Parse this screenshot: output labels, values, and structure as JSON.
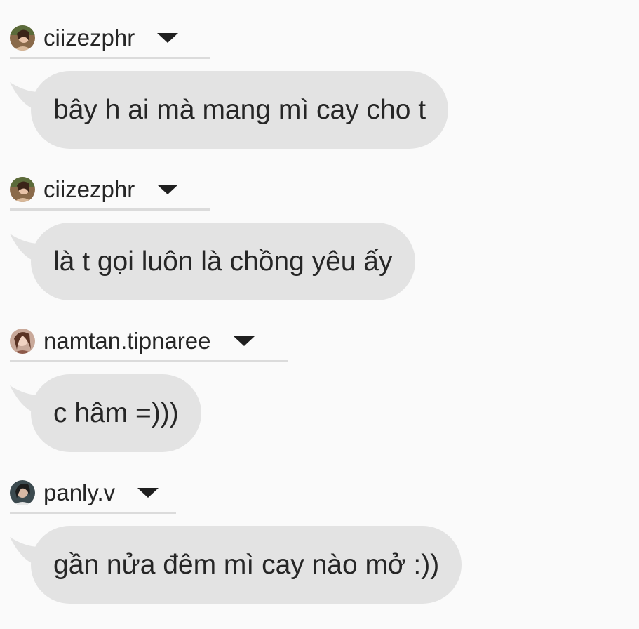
{
  "messages": [
    {
      "sender": {
        "username": "ciizezphr",
        "avatar": "avatar-photo-ciizezphr"
      },
      "text": "bây h ai mà mang mì cay cho t"
    },
    {
      "sender": {
        "username": "ciizezphr",
        "avatar": "avatar-photo-ciizezphr"
      },
      "text": "là t gọi luôn là chồng yêu ấy"
    },
    {
      "sender": {
        "username": "namtan.tipnaree",
        "avatar": "avatar-photo-namtan"
      },
      "text": "c hâm =)))"
    },
    {
      "sender": {
        "username": "panly.v",
        "avatar": "avatar-photo-panly"
      },
      "text": "gần nửa đêm mì cay nào mở :))"
    }
  ],
  "icons": {
    "dropdown": "caret-down-icon"
  },
  "colors": {
    "background": "#fafafa",
    "bubble": "#e3e3e3",
    "text": "#262626",
    "divider": "#dbdbdb"
  }
}
